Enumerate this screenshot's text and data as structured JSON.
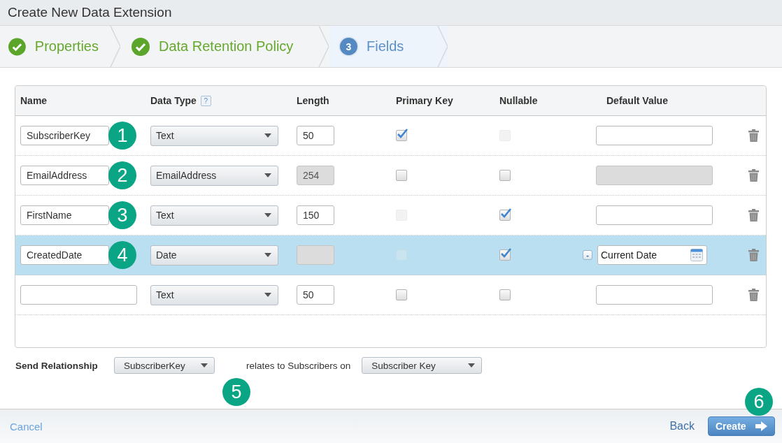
{
  "window": {
    "title": "Create New Data Extension"
  },
  "steps": [
    {
      "label": "Properties",
      "completed": true,
      "selected": false
    },
    {
      "label": "Data Retention Policy",
      "completed": true,
      "selected": false
    },
    {
      "label": "Fields",
      "completed": false,
      "selected": true,
      "number": "3"
    }
  ],
  "table": {
    "columns": [
      {
        "label": "Name"
      },
      {
        "label": "Data Type",
        "help": "?"
      },
      {
        "label": "Length"
      },
      {
        "label": "Primary Key"
      },
      {
        "label": "Nullable"
      },
      {
        "label": "Default Value"
      }
    ],
    "rows": [
      {
        "selected": false,
        "callout": "1",
        "name": "SubscriberKey",
        "data_type": "Text",
        "length": {
          "value": "50",
          "disabled": false
        },
        "primary_key": {
          "checked": true,
          "disabled": false
        },
        "nullable": {
          "checked": false,
          "disabled": true
        },
        "default_value": {
          "kind": "text",
          "disabled": false
        }
      },
      {
        "selected": false,
        "callout": "2",
        "name": "EmailAddress",
        "data_type": "EmailAddress",
        "length": {
          "value": "254",
          "disabled": true
        },
        "primary_key": {
          "checked": false,
          "disabled": false
        },
        "nullable": {
          "checked": false,
          "disabled": false
        },
        "default_value": {
          "kind": "text",
          "disabled": true
        }
      },
      {
        "selected": false,
        "callout": "3",
        "name": "FirstName",
        "data_type": "Text",
        "length": {
          "value": "150",
          "disabled": false
        },
        "primary_key": {
          "checked": false,
          "disabled": true
        },
        "nullable": {
          "checked": true,
          "disabled": false
        },
        "default_value": {
          "kind": "text",
          "disabled": false
        }
      },
      {
        "selected": true,
        "callout": "4",
        "name": "CreatedDate",
        "data_type": "Date",
        "length": {
          "disabled": true
        },
        "primary_key": {
          "checked": false,
          "disabled": true
        },
        "nullable": {
          "checked": true,
          "disabled": false
        },
        "default_value": {
          "kind": "date",
          "clear_button": "-",
          "value": "Current Date",
          "disabled": false
        }
      },
      {
        "selected": false,
        "data_type": "Text",
        "length": {
          "value": "50",
          "disabled": false
        },
        "primary_key": {
          "checked": false,
          "disabled": false
        },
        "nullable": {
          "checked": false,
          "disabled": false
        },
        "default_value": {
          "kind": "text",
          "disabled": false
        }
      }
    ]
  },
  "send_relationship": {
    "label": "Send Relationship",
    "field": "SubscriberKey",
    "callout": "5",
    "connector": "relates to Subscribers on",
    "subscriber_field": "Subscriber Key"
  },
  "footer": {
    "cancel": "Cancel",
    "back": "Back",
    "create": "Create",
    "create_callout": "6"
  }
}
